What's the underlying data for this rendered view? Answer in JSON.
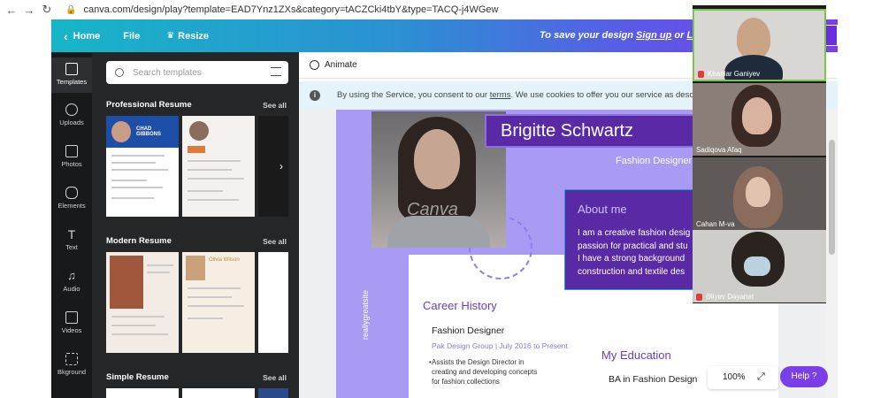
{
  "browser": {
    "back": "←",
    "forward": "→",
    "reload": "↻",
    "url": "canva.com/design/play?template=EAD7Ynz1ZXs&category=tACZCki4tbY&type=TACQ-j4WGew"
  },
  "header": {
    "home": "Home",
    "file": "File",
    "resize": "Resize",
    "save_prefix": "To save your design ",
    "signup": "Sign up",
    "or": " or ",
    "login": "Log in"
  },
  "rail": [
    {
      "label": "Templates"
    },
    {
      "label": "Uploads"
    },
    {
      "label": "Photos"
    },
    {
      "label": "Elements"
    },
    {
      "label": "Text"
    },
    {
      "label": "Audio"
    },
    {
      "label": "Videos"
    },
    {
      "label": "Bkground"
    }
  ],
  "panel": {
    "search_placeholder": "Search templates",
    "see_all": "See all",
    "sections": [
      {
        "title": "Professional Resume",
        "thumb1_name": "CHAD GIBBONS"
      },
      {
        "title": "Modern Resume",
        "thumb2_name": "Olivia Wilson"
      },
      {
        "title": "Simple Resume"
      }
    ]
  },
  "toolbar": {
    "animate": "Animate"
  },
  "cookie": {
    "prefix": "By using the Service, you consent to our ",
    "terms": "terms",
    "suffix": ". We use cookies to offer you our service as desc"
  },
  "design": {
    "name": "Brigitte Schwartz",
    "role": "Fashion Designer",
    "watermark": "Canva",
    "about_title": "About me",
    "about_text": "I am a creative fashion desig\npassion for practical and stu\nI have a strong background\nconstruction and textile des",
    "career_title": "Career History",
    "job_title": "Fashion Designer",
    "company": "Pak Design Group | July 2016 to Present",
    "bullet": "Assists the Design Director in\ncreating and developing concepts\nfor fashion collections",
    "education_title": "My Education",
    "degree": "BA in Fashion Design",
    "vertical": "reallygreatsite"
  },
  "zoom": {
    "value": "100%"
  },
  "help": {
    "label": "Help  ?"
  },
  "participants": [
    {
      "name": "Khanlar Ganiyev",
      "muted": true
    },
    {
      "name": "Sadiqova Afaq",
      "muted": false
    },
    {
      "name": "Cahan M-va",
      "muted": false
    },
    {
      "name": "Əliyev Dəyanət",
      "muted": true
    }
  ],
  "colors": {
    "accent": "#7a3fe8",
    "rail_bg": "#18191b",
    "panel_bg": "#252627",
    "design_lavender": "#a99bf4",
    "design_purple": "#5a2aa6"
  }
}
